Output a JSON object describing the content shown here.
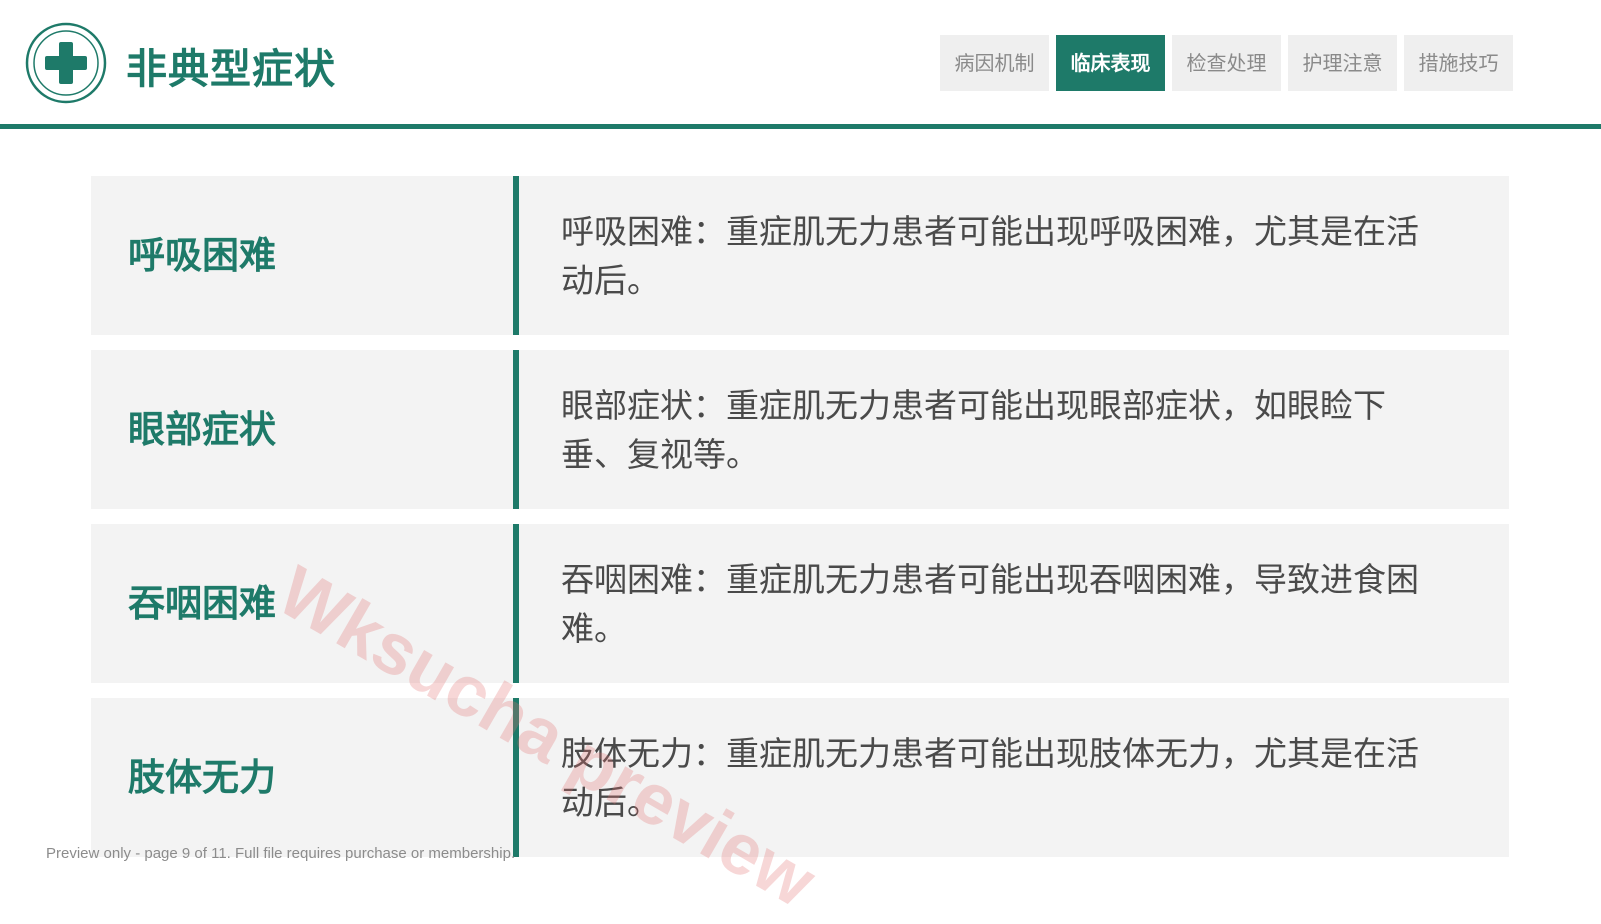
{
  "header": {
    "logo_icon": "medical-cross-icon",
    "title": "非典型症状",
    "tabs": [
      {
        "label": "病因机制",
        "active": false
      },
      {
        "label": "临床表现",
        "active": true
      },
      {
        "label": "检查处理",
        "active": false
      },
      {
        "label": "护理注意",
        "active": false
      },
      {
        "label": "措施技巧",
        "active": false
      }
    ]
  },
  "rows": [
    {
      "label": "呼吸困难",
      "text": "呼吸困难：重症肌无力患者可能出现呼吸困难，尤其是在活动后。"
    },
    {
      "label": "眼部症状",
      "text": "眼部症状：重症肌无力患者可能出现眼部症状，如眼睑下垂、复视等。"
    },
    {
      "label": "吞咽困难",
      "text": "吞咽困难：重症肌无力患者可能出现吞咽困难，导致进食困难。"
    },
    {
      "label": "肢体无力",
      "text": "肢体无力：重症肌无力患者可能出现肢体无力，尤其是在活动后。"
    }
  ],
  "watermark": "Wksucha preview",
  "footer": "Preview only - page 9 of 11. Full file requires purchase or membership.",
  "colors": {
    "accent": "#1e7a69",
    "row_bg": "#f3f3f3",
    "tab_bg": "#efefef",
    "tab_text": "#8a8a8a",
    "body_text": "#4a4a4a",
    "watermark": "#e26e6e"
  }
}
